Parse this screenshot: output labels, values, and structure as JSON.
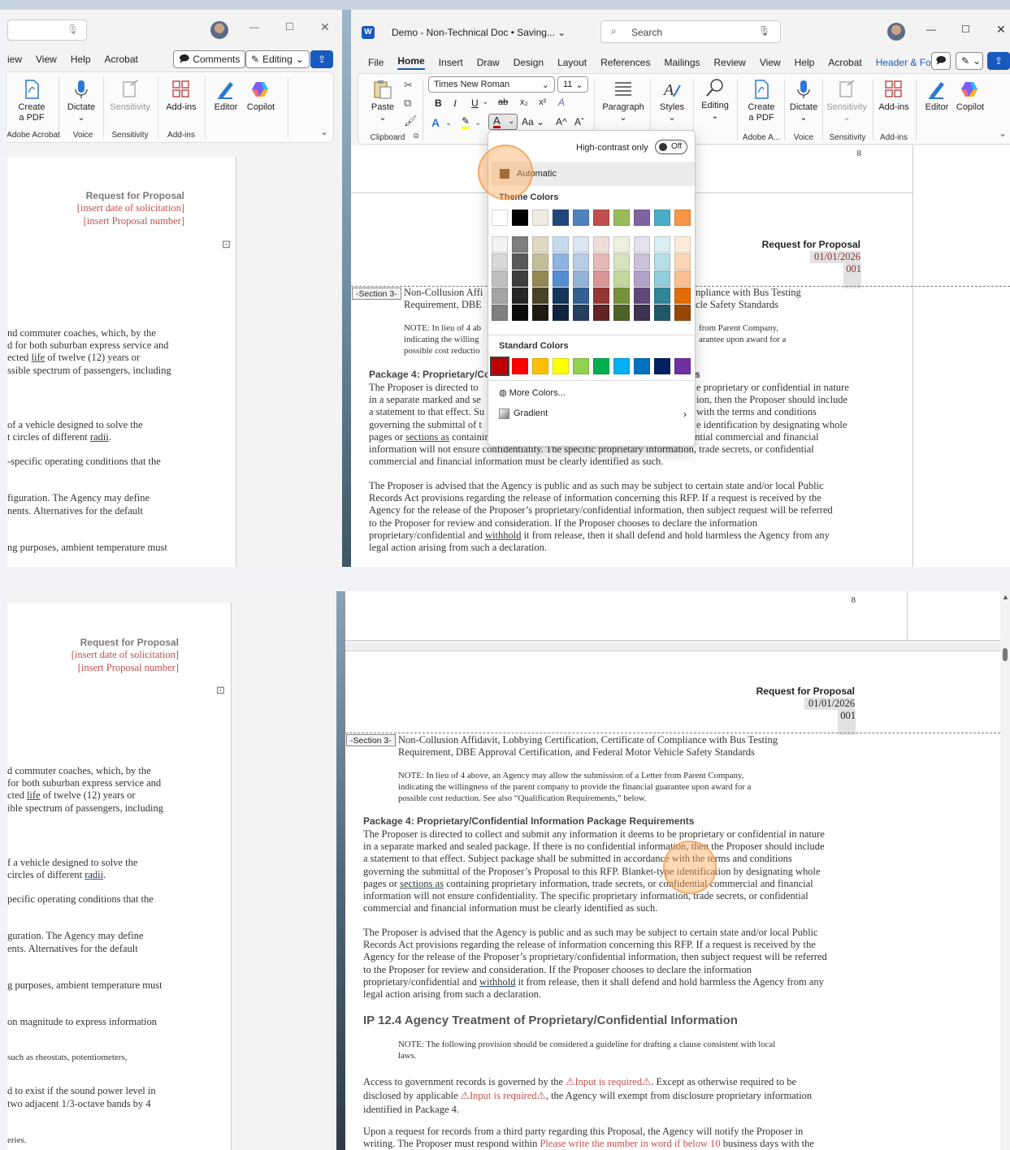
{
  "top_window": {
    "title": "Demo - Non-Technical Doc • Saving...",
    "search_placeholder": "Search",
    "menu": [
      "File",
      "Home",
      "Insert",
      "Draw",
      "Design",
      "Layout",
      "References",
      "Mailings",
      "Review",
      "View",
      "Help",
      "Acrobat",
      "Header & Footer"
    ],
    "left_menu": [
      "iew",
      "View",
      "Help",
      "Acrobat"
    ],
    "comments_label": "Comments",
    "editing_label": "Editing",
    "font_name": "Times New Roman",
    "font_size": "11",
    "buttons": {
      "paste": "Paste",
      "paragraph": "Paragraph",
      "styles": "Styles",
      "editing": "Editing",
      "create_pdf_1": "Create",
      "create_pdf_2": "a PDF",
      "dictate": "Dictate",
      "sensitivity": "Sensitivity",
      "addins": "Add-ins",
      "editor": "Editor",
      "copilot": "Copilot"
    },
    "groups": {
      "clipboard": "Clipboard",
      "adobe_short": "Adobe A...",
      "adobe_full": "Adobe Acrobat",
      "voice": "Voice",
      "sensitivity": "Sensitivity",
      "addins": "Add-ins"
    },
    "font_caps": {
      "bold": "B",
      "italic": "I",
      "underline": "U",
      "strike": "ab",
      "sub": "x₂",
      "sup": "x²",
      "clear": "A",
      "effects": "A",
      "highlight": "ab",
      "fontcolor": "A",
      "case": "Aa",
      "grow": "A^",
      "shrink": "Aˇ"
    }
  },
  "color_popup": {
    "high_contrast_label": "High-contrast only",
    "toggle_state": "Off",
    "automatic_label": "Automatic",
    "theme_title": "Theme Colors",
    "standard_title": "Standard Colors",
    "more_colors": "More Colors...",
    "gradient": "Gradient",
    "theme_top": [
      "#ffffff",
      "#000000",
      "#eeece1",
      "#1f497d",
      "#4f81bd",
      "#c0504d",
      "#9bbb59",
      "#8064a2",
      "#4bacc6",
      "#f79646"
    ],
    "theme_shades": [
      [
        "#f2f2f2",
        "#7f7f7f",
        "#ddd9c3",
        "#c6d9f0",
        "#dbe5f1",
        "#f2dcdb",
        "#ebf1dd",
        "#e5e0ec",
        "#dbeef3",
        "#fdeada"
      ],
      [
        "#d8d8d8",
        "#595959",
        "#c4bd97",
        "#8db3e2",
        "#b8cce4",
        "#e5b9b7",
        "#d7e3bc",
        "#ccc1d9",
        "#b7dde8",
        "#fbd5b5"
      ],
      [
        "#bfbfbf",
        "#3f3f3f",
        "#938953",
        "#548dd4",
        "#95b3d7",
        "#d99694",
        "#c3d69b",
        "#b2a2c7",
        "#92cddc",
        "#fac08f"
      ],
      [
        "#a5a5a5",
        "#262626",
        "#494429",
        "#17365d",
        "#366092",
        "#953734",
        "#76923c",
        "#5f497a",
        "#31859b",
        "#e36c09"
      ],
      [
        "#7f7f7f",
        "#0c0c0c",
        "#1d1b10",
        "#0f243e",
        "#244061",
        "#632423",
        "#4f6128",
        "#3f3151",
        "#205867",
        "#974806"
      ]
    ],
    "standard": [
      "#c00000",
      "#ff0000",
      "#ffc000",
      "#ffff00",
      "#92d050",
      "#00b050",
      "#00b0f0",
      "#0070c0",
      "#002060",
      "#7030a0"
    ]
  },
  "doc": {
    "page_number": "8",
    "rfp_title": "Request for Proposal",
    "rfp_date": "01/01/2026",
    "rfp_number": "001",
    "placeholder_date": "[insert date of solicitation]",
    "placeholder_number": "[insert Proposal number]",
    "section_tag": "-Section 3-",
    "section_line1": "Non-Collusion Affidavit, Lobbying Certification, Certificate of Compliance with Bus Testing",
    "section_line2": "Requirement, DBE Approval Certification, and Federal Motor Vehicle Safety Standards",
    "section_line1_a": "Non-Collusion Affi",
    "section_line1_b": "npliance with Bus Testing",
    "section_line2_a": "Requirement, DBE",
    "section_line2_b": "cle Safety Standards",
    "note1_l1": "NOTE: In lieu of 4 above, an Agency may allow the submission of a Letter from Parent Company,",
    "note1_l2": "indicating the willingness of the parent company to provide the financial guarantee upon award for a",
    "note1_l3": "possible cost reduction. See also “Qualification Requirements,” below.",
    "note1_a1": "NOTE: In lieu of 4 ab",
    "note1_a2": "indicating the willing",
    "note1_a3": "possible cost reductio",
    "note1_b1": "from Parent Company,",
    "note1_b2": "arantee upon award for a",
    "pkg_heading": "Package 4: Proprietary/Confidential Information Package Requirements",
    "pkg_heading_a": "Package 4: Proprietary/Cc",
    "pkg_heading_b": "s",
    "p1": [
      "The Proposer is directed to collect and submit any information it deems to be proprietary or confidential in nature",
      "in a separate marked and sealed package. If there is no confidential information, then the Proposer should include",
      "a statement to that effect. Subject package shall be submitted in accordance with the terms and conditions",
      "governing the submittal of the Proposer’s Proposal to this RFP. Blanket-type identification by designating whole",
      "containing proprietary information, trade secrets, or confidential commercial and financial",
      "information will not ensure confidentiality. The specific proprietary information, trade secrets, or confidential",
      "commercial and financial information must be clearly identified as such."
    ],
    "p1_pages": "pages or",
    "p1_sections": "sections as",
    "p1_clip_a": [
      "The Proposer is directed to",
      "in a separate marked and se",
      "a statement to that effect. Su",
      "governing the submittal of t"
    ],
    "p1_clip_b": [
      "e proprietary or confidential in nature",
      "ion, then the Proposer should include",
      "with the terms and conditions",
      "e identification by designating whole"
    ],
    "p2": [
      "The Proposer is advised that the Agency is public and as such may be subject to certain state and/or local Public",
      "Records Act provisions regarding the release of information concerning this RFP. If a request is received by the",
      "Agency for the release of the Proposer’s proprietary/confidential information, then subject request will be referred",
      "to the Proposer for review and consideration. If the Proposer chooses to declare the information"
    ],
    "p2_l5a": "proprietary/confidential and",
    "p2_withhold": "withhold",
    "p2_l5b": "it from release, then it shall defend and hold harmless the Agency from any",
    "p2_l6": "legal action arising from such a declaration.",
    "ip_heading": "IP 12.4 Agency Treatment of Proprietary/Confidential Information",
    "note2_l1": "NOTE: The following provision should be considered a guideline for drafting a clause consistent with local",
    "note2_l2": "laws.",
    "access_a": "Access to government records is governed by the",
    "input_required": "Input is required",
    "access_b": ". Except as otherwise required to be",
    "access_c": "disclosed by applicable",
    "access_d": ", the Agency will exempt from disclosure proprietary information",
    "access_e": "identified in Package 4.",
    "upon_l1": "Upon a request for records from a third party regarding this Proposal, the Agency will notify the Proposer in",
    "upon_l2a": "writing. The Proposer must respond within",
    "upon_l2b": "Please write the number in word if below 10",
    "upon_l2c": "business days with the",
    "left_lines": [
      [
        "nd commuter coaches, which, by the",
        "d commuter coaches, which, by the"
      ],
      [
        "d for both suburban express service and",
        "for both suburban express service and"
      ],
      [
        "ected",
        "cted"
      ],
      [
        "ssible spectrum of passengers, including",
        "ible spectrum of passengers, including"
      ],
      [
        "of a vehicle designed to solve the",
        "f a vehicle designed to solve the"
      ],
      [
        "t circles of different",
        "circles of different"
      ],
      [
        "-specific operating conditions that the",
        "pecific operating conditions that the"
      ],
      [
        "figuration. The Agency may define",
        "guration. The Agency may define"
      ],
      [
        "nents. Alternatives for the default",
        "ents. Alternatives for the default"
      ],
      [
        "ng purposes, ambient temperature must",
        "g purposes, ambient temperature must"
      ]
    ],
    "left_life": "life",
    "left_life_tail": "of twelve (12) years or",
    "left_radii": "radii",
    "left_extra": [
      "on magnitude to express information",
      "such as rheostats, potentiometers,",
      "d to exist if the sound power level in",
      "two adjacent 1/3-octave bands by 4",
      "eries."
    ]
  }
}
